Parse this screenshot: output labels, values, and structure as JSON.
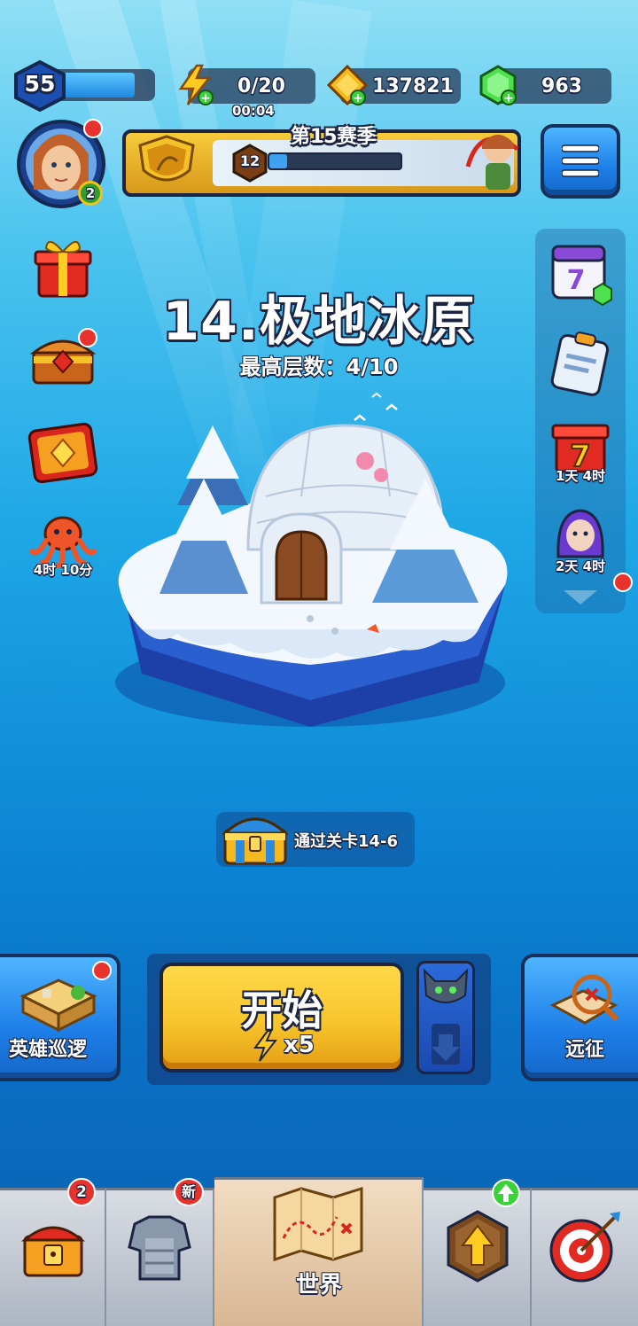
{
  "top_bar": {
    "level": "55",
    "energy": "0/20",
    "energy_timer": "00:04",
    "gold": "137821",
    "gems": "963"
  },
  "season": {
    "title": "第15赛季",
    "rank": "12"
  },
  "avatar": {
    "badge": "2"
  },
  "left_side": {
    "octopus_timer": "4时 10分"
  },
  "right_side": {
    "gift_timer": "1天 4时",
    "hero_timer": "2天 4时"
  },
  "stage": {
    "title": "14.极地冰原",
    "subtitle": "最高层数：4/10"
  },
  "chest_reward": {
    "label": "通过关卡14-6"
  },
  "actions": {
    "patrol_label": "英雄巡逻",
    "start_label": "开始",
    "start_cost": "x5",
    "expedition_label": "远征"
  },
  "bottom_nav": {
    "shop_badge": "2",
    "equipment_badge": "新",
    "world_label": "世界"
  },
  "colors": {
    "sea_top": "#8fdff5",
    "sea_bottom": "#0a5fb0",
    "start_button": "#f7c52c",
    "blue_button": "#1d7fe8",
    "notification": "#e8322d"
  }
}
